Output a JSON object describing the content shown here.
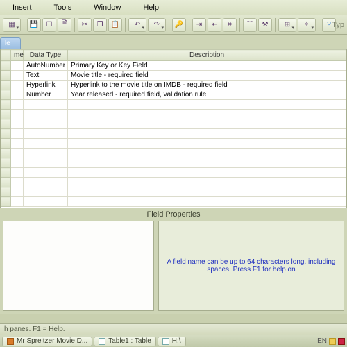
{
  "menu": {
    "insert": "Insert",
    "tools": "Tools",
    "window": "Window",
    "help": "Help"
  },
  "typehint": "Typ",
  "table": {
    "title": "le",
    "columns": {
      "name": "me",
      "datatype": "Data Type",
      "description": "Description"
    },
    "rows": [
      {
        "name": "",
        "type": "AutoNumber",
        "desc": "Primary Key or Key Field"
      },
      {
        "name": "",
        "type": "Text",
        "desc": "Movie title - required field"
      },
      {
        "name": "",
        "type": "Hyperlink",
        "desc": "Hyperlink to the movie title on IMDB - required field"
      },
      {
        "name": "",
        "type": "Number",
        "desc": "Year released - required field, validation rule"
      }
    ]
  },
  "fieldprops": {
    "label": "Field Properties",
    "hint": "A field name can be up to 64 characters long, including spaces.  Press F1 for help on"
  },
  "status": "h panes.  F1 = Help.",
  "windowbar": {
    "items": [
      {
        "label": "Mr Spreitzer Movie D..."
      },
      {
        "label": "Table1 : Table"
      },
      {
        "label": "H:\\"
      }
    ],
    "lang": "EN"
  }
}
